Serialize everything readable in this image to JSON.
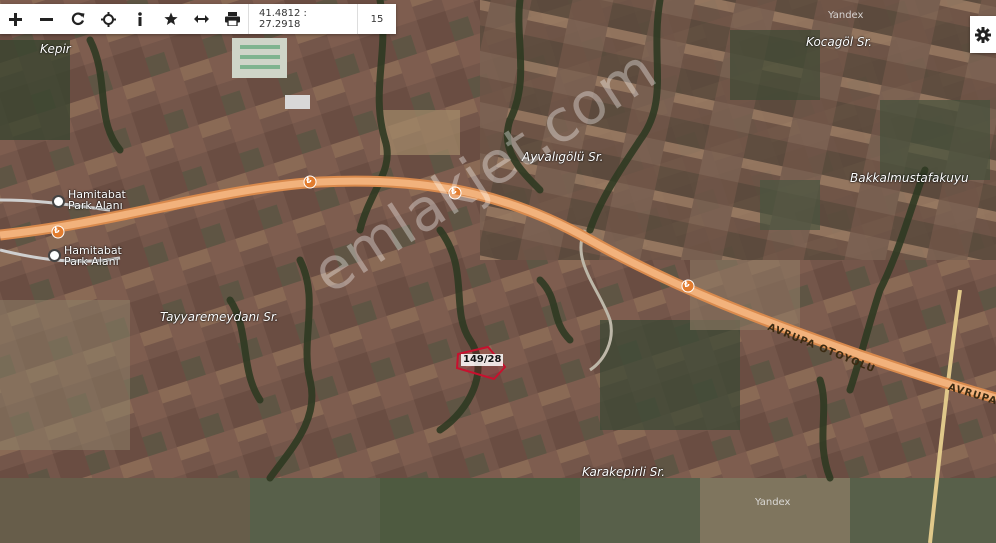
{
  "toolbar": {
    "zoom_in_icon": "plus-icon",
    "zoom_out_icon": "minus-icon",
    "refresh_icon": "refresh-icon",
    "locate_icon": "crosshair-icon",
    "info_icon": "info-icon",
    "favorite_icon": "star-icon",
    "measure_icon": "horizontal-arrows-icon",
    "print_icon": "printer-icon",
    "coordinates": "41.4812 : 27.2918",
    "zoom_level": "15"
  },
  "settings_icon": "gear-icon",
  "places": {
    "kepir": "Kepir",
    "kocagol": "Kocagöl Sr.",
    "ayvaligolu": "Ayvalıgölü Sr.",
    "bakkalmustafakuyu": "Bakkalmustafakuyu",
    "tayyaremeydani": "Tayyaremeydanı Sr.",
    "karakepirli": "Karakepirli Sr."
  },
  "parks": {
    "park1_line1": "Hamitabat",
    "park1_line2": "Park Alanı",
    "park2_line1": "Hamitabat",
    "park2_line2": "Park Alanı"
  },
  "road": {
    "label_1": "AVRUPA OTOYOLU",
    "label_2": "AVRUPA",
    "toll_symbol": "₺"
  },
  "parcel": {
    "label": "149/28"
  },
  "attribution": {
    "yandex_1": "Yandex",
    "yandex_2": "Yandex"
  },
  "watermark": "emlakjet.com",
  "colors": {
    "highway": "#f2b27c",
    "highway_edge": "#d98a4d",
    "parcel_outline": "#c8102e",
    "ridge": "#2f3a22"
  }
}
